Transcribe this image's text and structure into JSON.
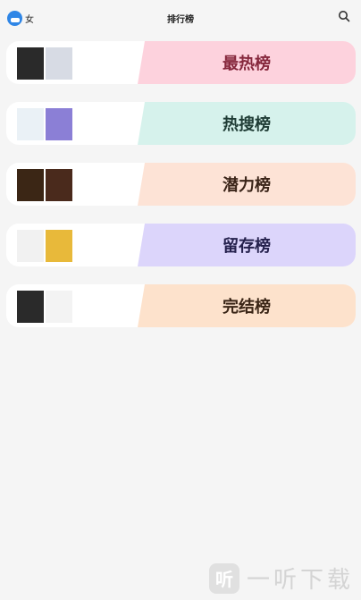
{
  "header": {
    "gender_label": "女",
    "title": "排行榜"
  },
  "rankings": [
    {
      "name": "最热榜",
      "tint": "#fdd2dd",
      "text_color": "#86283d",
      "covers": [
        {
          "bg": "#2a2a2a",
          "fg": "#ffffff",
          "text": ""
        },
        {
          "bg": "#d7dbe4",
          "fg": "#2b2b2b",
          "text": ""
        }
      ]
    },
    {
      "name": "热搜榜",
      "tint": "#d6f2ec",
      "text_color": "#1f3c35",
      "covers": [
        {
          "bg": "#eaf1f6",
          "fg": "#444444",
          "text": ""
        },
        {
          "bg": "#8b7fd6",
          "fg": "#ffffff",
          "text": ""
        }
      ]
    },
    {
      "name": "潜力榜",
      "tint": "#fde3d6",
      "text_color": "#3a2418",
      "covers": [
        {
          "bg": "#3b2615",
          "fg": "#f0d08a",
          "text": ""
        },
        {
          "bg": "#4a2a1c",
          "fg": "#ffd9a0",
          "text": ""
        }
      ]
    },
    {
      "name": "留存榜",
      "tint": "#dcd5fb",
      "text_color": "#25214d",
      "covers": [
        {
          "bg": "#f1f1f1",
          "fg": "#222222",
          "text": ""
        },
        {
          "bg": "#e8b93a",
          "fg": "#3a2600",
          "text": ""
        }
      ]
    },
    {
      "name": "完结榜",
      "tint": "#fde2cc",
      "text_color": "#3a2516",
      "covers": [
        {
          "bg": "#2a2a2a",
          "fg": "#ffffff",
          "text": ""
        },
        {
          "bg": "#f3f3f3",
          "fg": "#222222",
          "text": ""
        }
      ]
    }
  ],
  "watermark": {
    "logo_char": "听",
    "text": "一听下载"
  }
}
